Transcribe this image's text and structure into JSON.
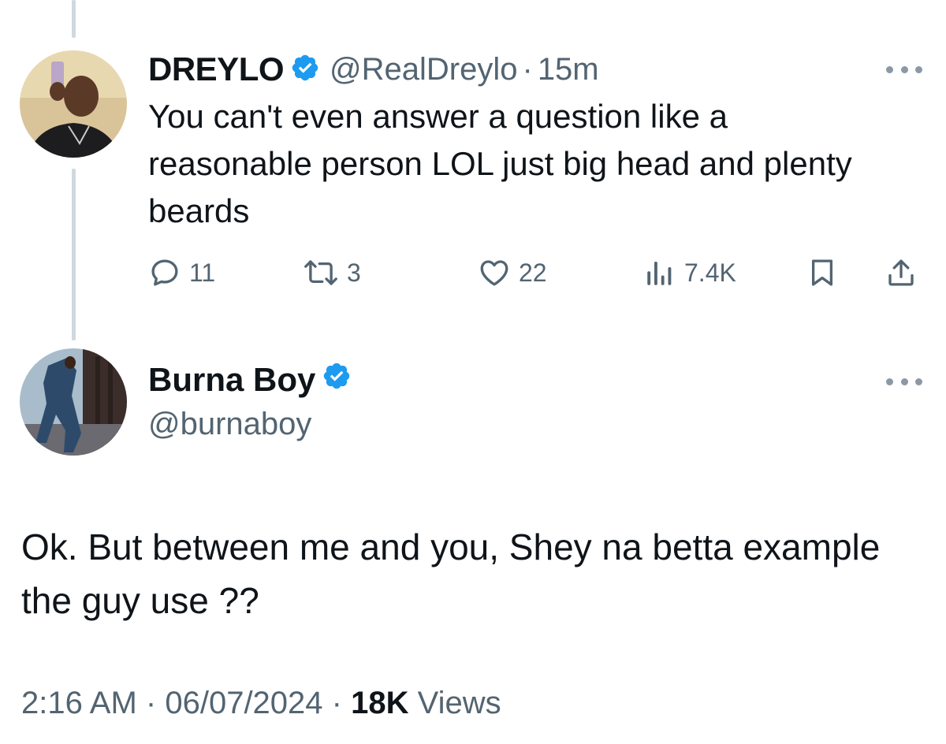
{
  "reply_tweet": {
    "display_name": "DREYLO",
    "handle": "@RealDreylo",
    "separator": "·",
    "time": "15m",
    "text": "You can't even answer a question like a reasonable person LOL just big head and plenty beards",
    "replies": "11",
    "reposts": "3",
    "likes": "22",
    "views": "7.4K",
    "icons": [
      "verified-badge",
      "more-dots",
      "reply",
      "repost",
      "like",
      "views",
      "bookmark",
      "share"
    ]
  },
  "main_tweet": {
    "display_name": "Burna Boy",
    "handle": "@burnaboy",
    "text": "Ok. But between me and you, Shey na betta example the guy use ??",
    "time": "2:16 AM",
    "sep1": "·",
    "date": "06/07/2024",
    "sep2": "·",
    "views_count": "18K",
    "views_label": "Views",
    "icons": [
      "verified-badge",
      "more-dots"
    ]
  },
  "colors": {
    "text": "#0f1419",
    "muted": "#536471",
    "verified": "#1d9bf0",
    "thread_line": "#cfd9de"
  }
}
